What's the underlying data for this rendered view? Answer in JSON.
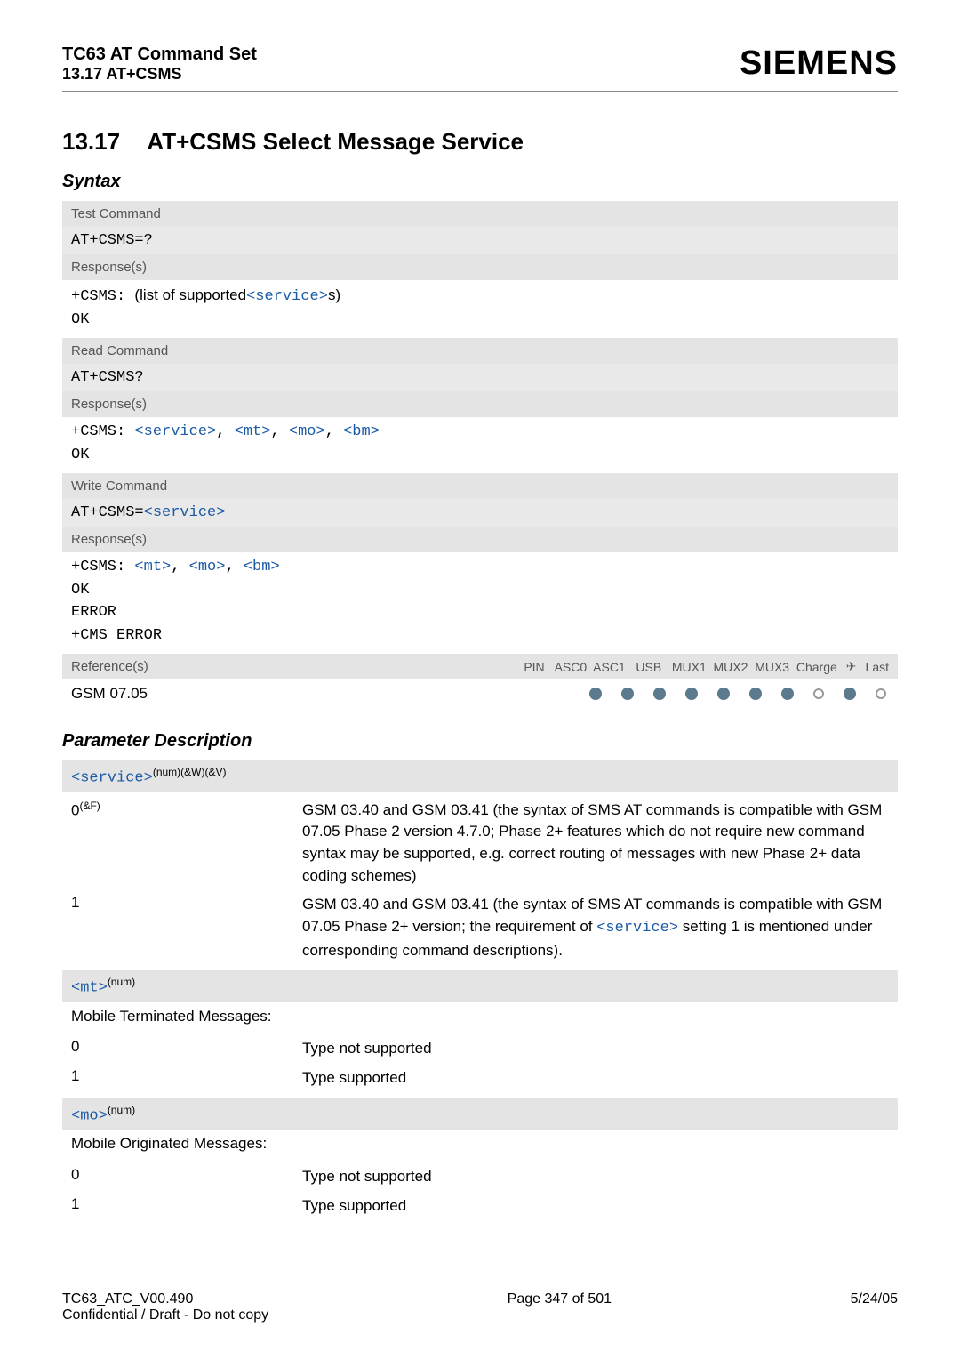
{
  "header": {
    "title": "TC63 AT Command Set",
    "subtitle": "13.17 AT+CSMS",
    "brand": "SIEMENS"
  },
  "section": {
    "number": "13.17",
    "title": "AT+CSMS   Select Message Service"
  },
  "syntax_heading": "Syntax",
  "blocks": {
    "test": {
      "label": "Test Command",
      "cmd": "AT+CSMS=?",
      "resp_label": "Response(s)",
      "resp_prefix": "+CSMS: ",
      "resp_mid1": "(list of supported",
      "resp_link": "<service>",
      "resp_mid2": "s)",
      "ok": "OK"
    },
    "read": {
      "label": "Read Command",
      "cmd": "AT+CSMS?",
      "resp_label": "Response(s)",
      "resp_prefix": "+CSMS: ",
      "links": {
        "a": "<service>",
        "b": "<mt>",
        "c": "<mo>",
        "d": "<bm>"
      },
      "ok": "OK"
    },
    "write": {
      "label": "Write Command",
      "cmd_prefix": "AT+CSMS=",
      "cmd_link": "<service>",
      "resp_label": "Response(s)",
      "resp_prefix": "+CSMS: ",
      "links": {
        "a": "<mt>",
        "b": "<mo>",
        "c": "<bm>"
      },
      "ok": "OK",
      "error": "ERROR",
      "cms": "+CMS ERROR"
    }
  },
  "reference": {
    "label": "Reference(s)",
    "cols": "PIN   ASC0  ASC1   USB   MUX1  MUX2  MUX3  Charge",
    "last": "Last",
    "arrow": "✈",
    "name": "GSM 07.05"
  },
  "params_heading": "Parameter Description",
  "params": {
    "service": {
      "name": "<service>",
      "sup": "(num)(&W)(&V)",
      "rows": {
        "r0": {
          "key": "0",
          "keysup": "(&F)",
          "desc": "GSM 03.40 and GSM 03.41 (the syntax of SMS AT commands is compatible with GSM 07.05 Phase 2 version 4.7.0; Phase 2+ features which do not require new command syntax may be supported, e.g. correct routing of messages with new Phase 2+ data coding schemes)"
        },
        "r1": {
          "key": "1",
          "desc_a": "GSM 03.40 and GSM 03.41 (the syntax of SMS AT commands is compatible with GSM 07.05 Phase 2+ version; the requirement of ",
          "desc_link": "<service>",
          "desc_b": " setting 1 is mentioned under corresponding command descriptions)."
        }
      }
    },
    "mt": {
      "name": "<mt>",
      "sup": "(num)",
      "title": "Mobile Terminated Messages:",
      "rows": {
        "r0": {
          "key": "0",
          "desc": "Type not supported"
        },
        "r1": {
          "key": "1",
          "desc": "Type supported"
        }
      }
    },
    "mo": {
      "name": "<mo>",
      "sup": "(num)",
      "title": "Mobile Originated Messages:",
      "rows": {
        "r0": {
          "key": "0",
          "desc": "Type not supported"
        },
        "r1": {
          "key": "1",
          "desc": "Type supported"
        }
      }
    }
  },
  "footer": {
    "left1": "TC63_ATC_V00.490",
    "left2": "Confidential / Draft - Do not copy",
    "center": "Page 347 of 501",
    "right": "5/24/05"
  }
}
